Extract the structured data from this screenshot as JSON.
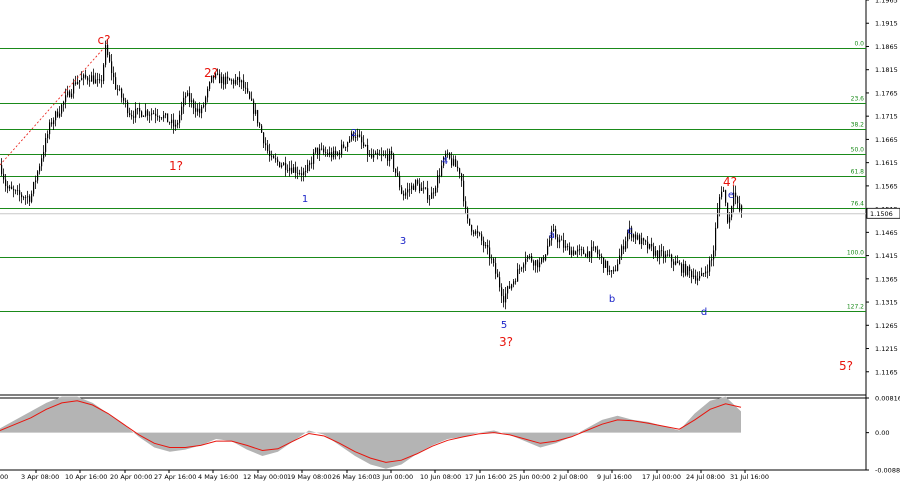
{
  "chart_data": [
    {
      "type": "candlestick",
      "instrument_note": "",
      "price_axis": {
        "min": 1.1115,
        "max": 1.1965,
        "ticks": [
          "1.1965",
          "1.1915",
          "1.1865",
          "1.1815",
          "1.1765",
          "1.1715",
          "1.1665",
          "1.1615",
          "1.1565",
          "1.1515",
          "1.1465",
          "1.1415",
          "1.1365",
          "1.1315",
          "1.1265",
          "1.1215",
          "1.1165"
        ],
        "current_price": "1.1506"
      },
      "time_axis": {
        "ticks": [
          "3 Apr 08:00",
          "10 Apr 16:00",
          "20 Apr 00:00",
          "27 Apr 16:00",
          "4 May 16:00",
          "12 May 00:00",
          "19 May 08:00",
          "26 May 16:00",
          "3 Jun 00:00",
          "10 Jun 08:00",
          "17 Jun 16:00",
          "25 Jun 00:00",
          "2 Jul 08:00",
          "9 Jul 16:00",
          "17 Jul 00:00",
          "24 Jul 08:00",
          "31 Jul 16:00"
        ],
        "first_tick_partial": "00"
      },
      "fib_levels": [
        {
          "label": "0.0",
          "price": 1.1862
        },
        {
          "label": "23.6",
          "price": 1.1743
        },
        {
          "label": "38.2",
          "price": 1.1687
        },
        {
          "label": "50.0",
          "price": 1.1634
        },
        {
          "label": "61.8",
          "price": 1.1586
        },
        {
          "label": "76.4",
          "price": 1.1518
        },
        {
          "label": "100.0",
          "price": 1.1413
        },
        {
          "label": "127.2",
          "price": 1.1296
        }
      ],
      "wave_labels_red": [
        "c?",
        "2?",
        "1?",
        "3?",
        "4?",
        "5?"
      ],
      "wave_labels_blue": [
        "1",
        "2",
        "3",
        "4",
        "5",
        "a",
        "b",
        "c",
        "d",
        "e"
      ],
      "colors": {
        "fib_line": "#1a8a1a",
        "candles": "#000000",
        "wave_red": "#e8150d",
        "wave_blue": "#1a23c8",
        "trendline": "#e8150d"
      }
    },
    {
      "type": "oscillator",
      "axis_ticks": [
        "0.00816",
        "0.00",
        "-0.0088"
      ],
      "histogram_color": "#b4b4b4",
      "signal_color": "#e8150d",
      "histogram": [
        0.001,
        0.003,
        0.005,
        0.007,
        0.0085,
        0.0085,
        0.007,
        0.0045,
        0.002,
        -0.001,
        -0.0035,
        -0.0045,
        -0.004,
        -0.003,
        -0.0015,
        -0.002,
        -0.004,
        -0.0055,
        -0.0045,
        -0.002,
        0.0005,
        -0.0005,
        -0.003,
        -0.0055,
        -0.0075,
        -0.0085,
        -0.0075,
        -0.005,
        -0.003,
        -0.0015,
        -0.001,
        0.0,
        0.0005,
        -0.0005,
        -0.002,
        -0.0035,
        -0.0025,
        -0.001,
        0.001,
        0.003,
        0.004,
        0.003,
        0.0025,
        0.0015,
        0.0005,
        0.0045,
        0.0075,
        0.0085,
        0.005
      ],
      "signal": [
        0.0005,
        0.002,
        0.0035,
        0.0055,
        0.007,
        0.0075,
        0.0065,
        0.0045,
        0.002,
        -0.0005,
        -0.0025,
        -0.0035,
        -0.0035,
        -0.003,
        -0.002,
        -0.002,
        -0.003,
        -0.0042,
        -0.0038,
        -0.002,
        -0.0002,
        -0.0008,
        -0.0025,
        -0.0045,
        -0.006,
        -0.007,
        -0.0065,
        -0.005,
        -0.0032,
        -0.0018,
        -0.001,
        -0.0003,
        0.0,
        -0.0005,
        -0.0015,
        -0.0025,
        -0.002,
        -0.001,
        0.0005,
        0.002,
        0.003,
        0.0028,
        0.0022,
        0.0015,
        0.0008,
        0.003,
        0.0055,
        0.0068,
        0.006
      ]
    }
  ]
}
